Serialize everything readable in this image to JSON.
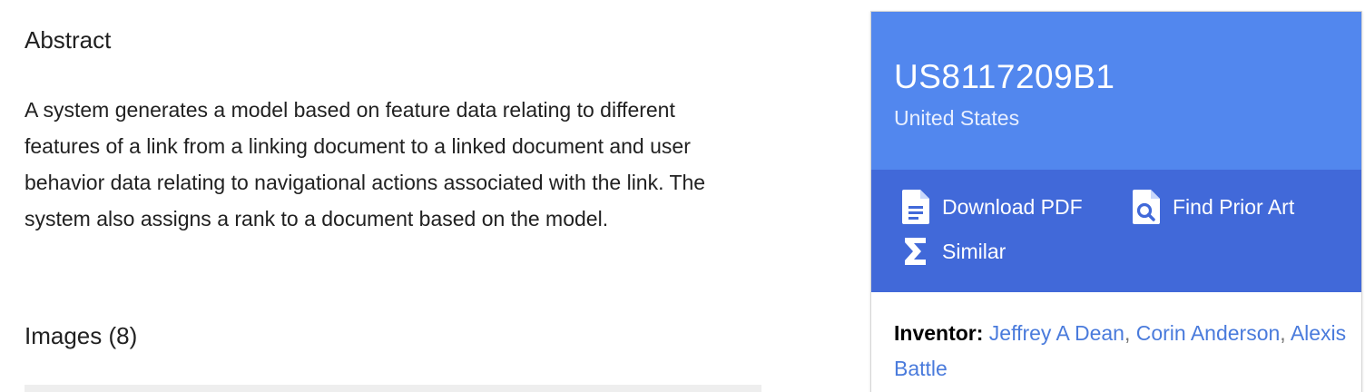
{
  "abstract": {
    "heading": "Abstract",
    "text": "A system generates a model based on feature data relating to different features of a link from a linking document to a linked document and user behavior data relating to navigational actions associated with the link. The system also assigns a rank to a document based on the model."
  },
  "images": {
    "heading": "Images (8)"
  },
  "patent": {
    "number": "US8117209B1",
    "country": "United States"
  },
  "actions": {
    "download_pdf": {
      "label": "Download PDF",
      "icon": "document-icon"
    },
    "find_prior_art": {
      "label": "Find Prior Art",
      "icon": "search-document-icon"
    },
    "similar": {
      "label": "Similar",
      "icon": "sigma-icon"
    }
  },
  "inventors": {
    "label": "Inventor:",
    "names": [
      "Jeffrey A Dean",
      "Corin Anderson",
      "Alexis Battle"
    ],
    "separator": ","
  },
  "colors": {
    "header_bg": "#5287ee",
    "actions_bg": "#4169d9",
    "link": "#4a7bdc"
  }
}
